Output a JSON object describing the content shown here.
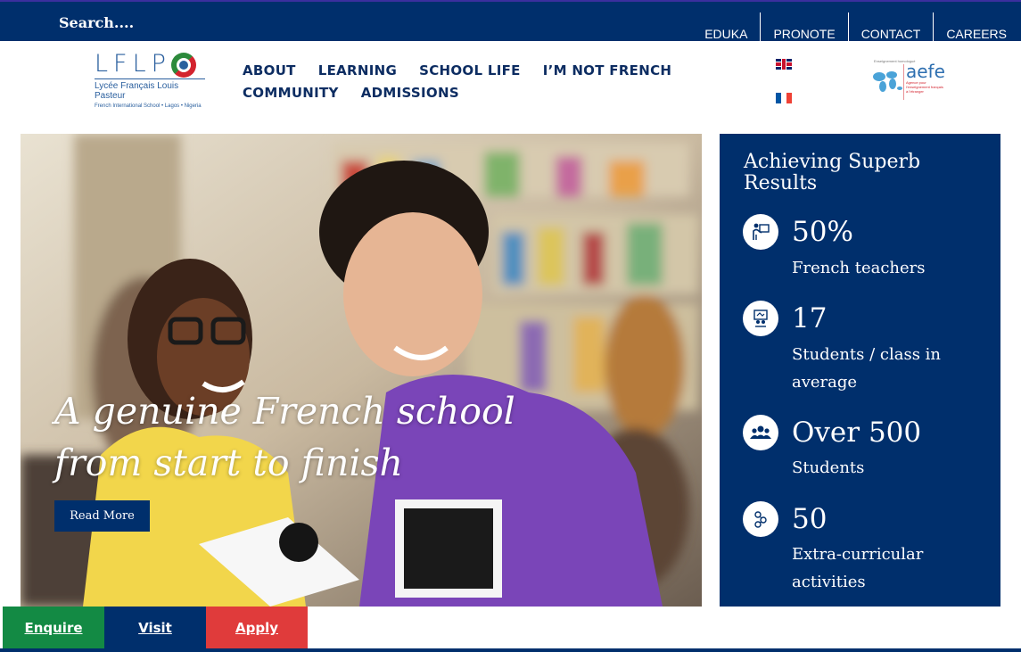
{
  "topbar": {
    "search_label": "Search....",
    "links": [
      "EDUKA",
      "PRONOTE",
      "CONTACT",
      "CAREERS"
    ]
  },
  "logo": {
    "letters": "LFLP",
    "line1": "Lycée Français Louis Pasteur",
    "line2": "French International School • Lagos • Nigeria"
  },
  "nav": {
    "items": [
      "ABOUT",
      "LEARNING",
      "SCHOOL LIFE",
      "I’M NOT FRENCH",
      "COMMUNITY",
      "ADMISSIONS"
    ]
  },
  "languages": [
    "English",
    "Français"
  ],
  "aefe": {
    "name": "aefe",
    "tagline": "Enseignement homologué",
    "sub": "Agence pour l'enseignement français à l'étranger"
  },
  "hero": {
    "title_line1": "A genuine French school",
    "title_line2": "from start to finish",
    "button": "Read More"
  },
  "results": {
    "title": "Achieving Superb Results",
    "stats": [
      {
        "icon": "teacher-icon",
        "value": "50%",
        "label": "French teachers"
      },
      {
        "icon": "classroom-icon",
        "value": "17",
        "label": "Students / class in average"
      },
      {
        "icon": "group-icon",
        "value": "Over 500",
        "label": "Students"
      },
      {
        "icon": "activities-icon",
        "value": "50",
        "label": "Extra-curricular activities"
      }
    ]
  },
  "ctas": {
    "enquire": "Enquire",
    "visit": "Visit",
    "apply": "Apply"
  },
  "colors": {
    "navy": "#002f6c",
    "green": "#138a44",
    "red": "#e03b3b",
    "white": "#ffffff"
  }
}
